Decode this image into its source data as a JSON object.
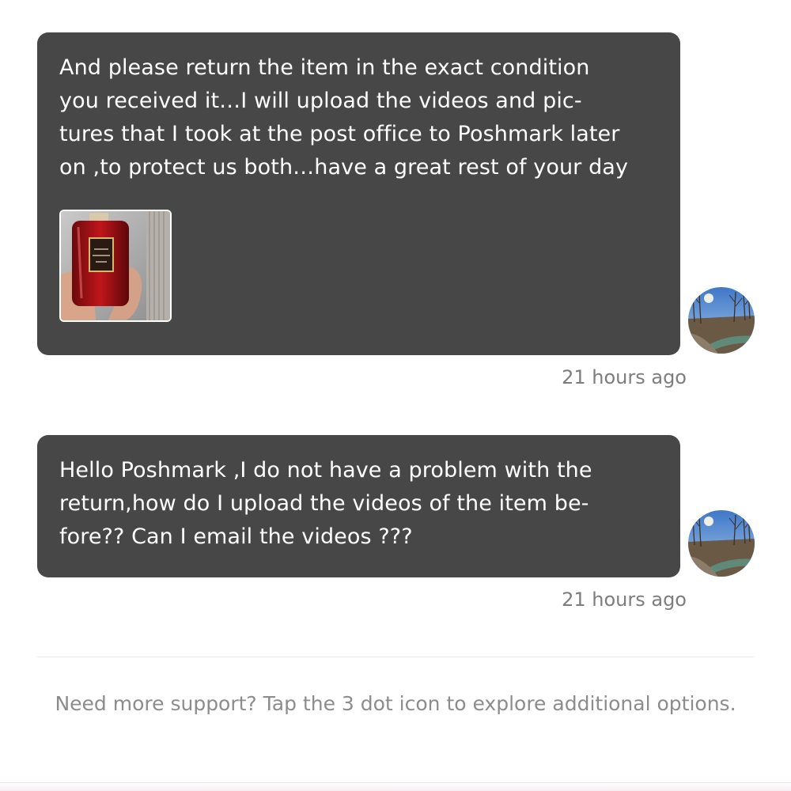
{
  "messages": [
    {
      "text": "And please return the item in the exact condition\nyou received it…I will upload the videos and pic-\ntures that I took at the post office to Poshmark later\non ,to protect us both…have a great rest of your day",
      "has_image": true,
      "image_icon": "perfume-bottle-photo",
      "timestamp": "21 hours ago"
    },
    {
      "text": "Hello Poshmark ,I do not have a problem with the\nreturn,how do I upload the videos of the item be-\nfore?? Can I email the videos ???",
      "has_image": false,
      "timestamp": "21 hours ago"
    }
  ],
  "avatar_icon": "river-landscape-avatar",
  "support_text": "Need more support? Tap the 3 dot icon to explore additional options.",
  "colors": {
    "bubble": "#474747",
    "bubble_text": "#ffffff",
    "timestamp": "#7d7d7d",
    "support_text": "#8c8c8c",
    "background": "#ffffff"
  }
}
